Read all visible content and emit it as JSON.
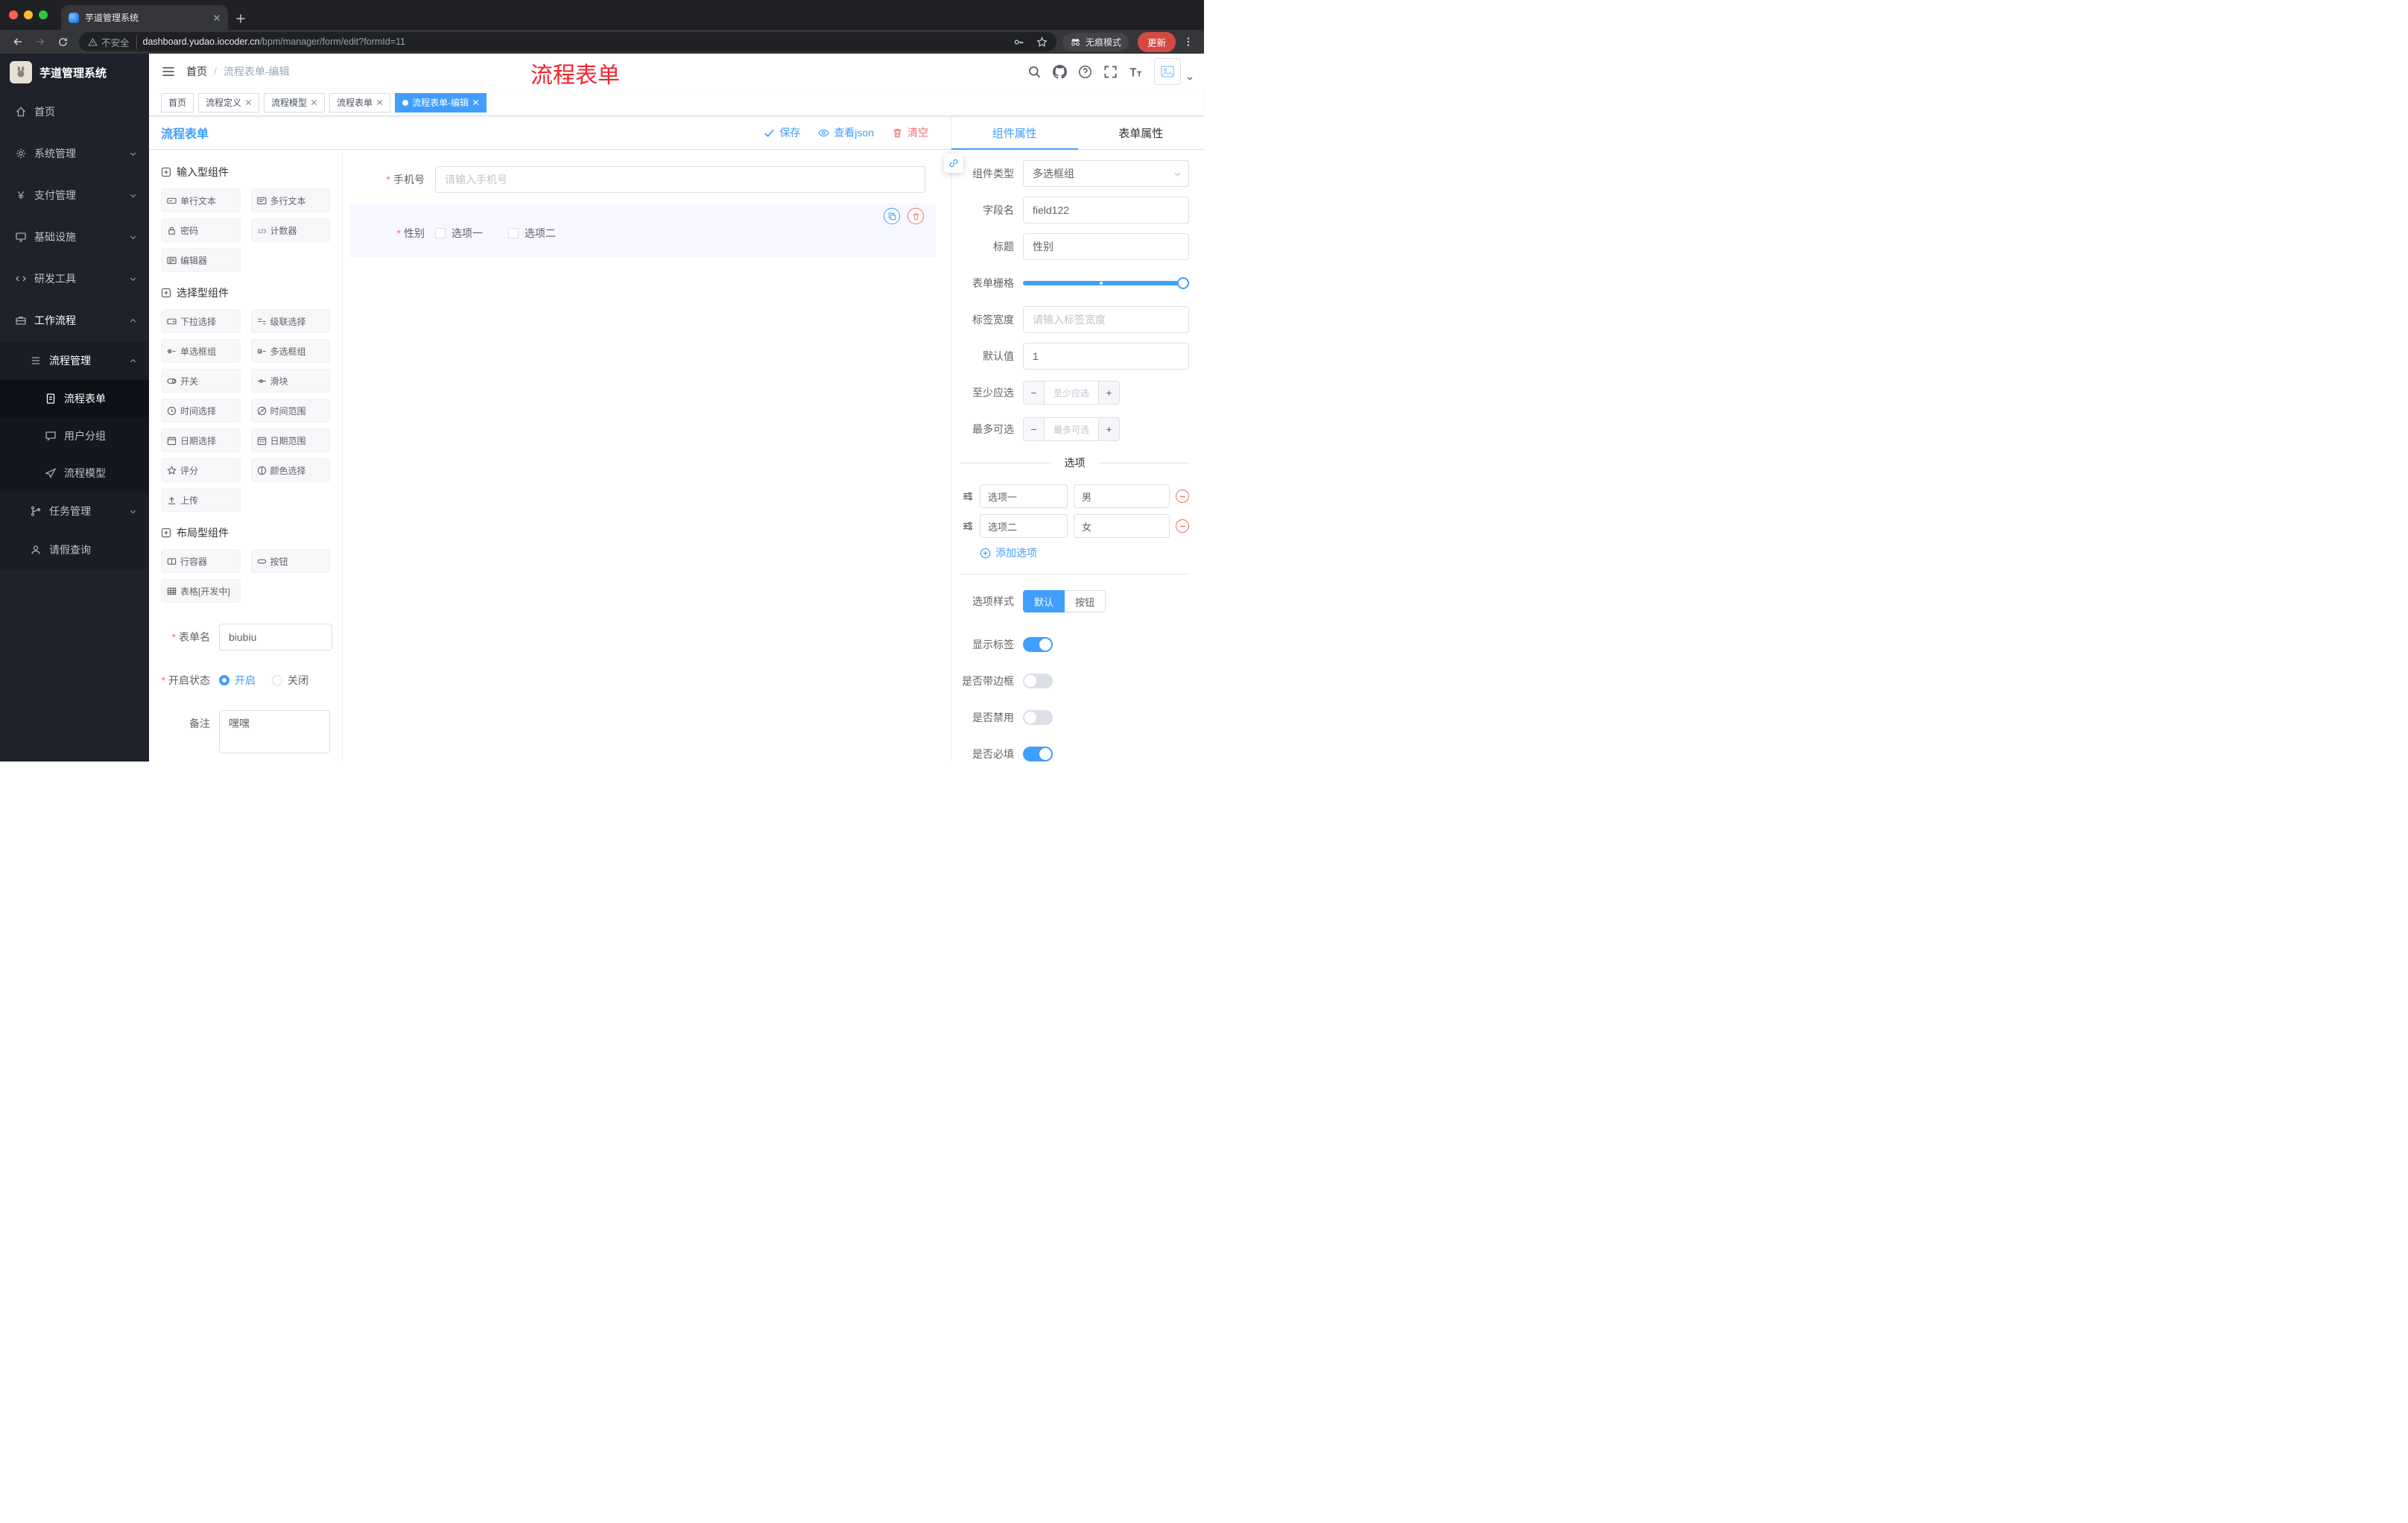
{
  "colors": {
    "accent": "#409eff",
    "danger": "#f56c6c",
    "annotation_red": "#f5222d",
    "active_tag": "#409eff"
  },
  "browser": {
    "tab_title": "芋道管理系统",
    "security_label": "不安全",
    "url_domain": "dashboard.yudao.iocoder.cn",
    "url_path": "/bpm/manager/form/edit?formId=11",
    "incognito_label": "无痕模式",
    "update_label": "更新"
  },
  "sidebar": {
    "logo_title": "芋道管理系统",
    "items": [
      {
        "label": "首页"
      },
      {
        "label": "系统管理"
      },
      {
        "label": "支付管理"
      },
      {
        "label": "基础设施"
      },
      {
        "label": "研发工具"
      },
      {
        "label": "工作流程"
      },
      {
        "label": "流程管理"
      },
      {
        "label": "流程表单"
      },
      {
        "label": "用户分组"
      },
      {
        "label": "流程模型"
      },
      {
        "label": "任务管理"
      },
      {
        "label": "请假查询"
      }
    ]
  },
  "header": {
    "breadcrumb_root": "首页",
    "breadcrumb_sep": "/",
    "breadcrumb_current": "流程表单-编辑",
    "annotation": "流程表单"
  },
  "tags": [
    {
      "label": "首页"
    },
    {
      "label": "流程定义"
    },
    {
      "label": "流程模型"
    },
    {
      "label": "流程表单"
    },
    {
      "label": "流程表单-编辑"
    }
  ],
  "designer": {
    "title": "流程表单",
    "actions": {
      "save": "保存",
      "view_json": "查看json",
      "clear": "清空"
    },
    "palette": {
      "sections": [
        {
          "title": "输入型组件",
          "items": [
            {
              "label": "单行文本"
            },
            {
              "label": "多行文本"
            },
            {
              "label": "密码"
            },
            {
              "label": "计数器"
            },
            {
              "label": "编辑器"
            }
          ]
        },
        {
          "title": "选择型组件",
          "items": [
            {
              "label": "下拉选择"
            },
            {
              "label": "级联选择"
            },
            {
              "label": "单选框组"
            },
            {
              "label": "多选框组"
            },
            {
              "label": "开关"
            },
            {
              "label": "滑块"
            },
            {
              "label": "时间选择"
            },
            {
              "label": "时间范围"
            },
            {
              "label": "日期选择"
            },
            {
              "label": "日期范围"
            },
            {
              "label": "评分"
            },
            {
              "label": "颜色选择"
            },
            {
              "label": "上传"
            }
          ]
        },
        {
          "title": "布局型组件",
          "items": [
            {
              "label": "行容器"
            },
            {
              "label": "按钮"
            },
            {
              "label": "表格[开发中]"
            }
          ]
        }
      ],
      "meta": {
        "name_label": "表单名",
        "name_value": "biubiu",
        "status_label": "开启状态",
        "status_on": "开启",
        "status_off": "关闭",
        "remark_label": "备注",
        "remark_value": "嘿嘿"
      }
    },
    "canvas": {
      "phone": {
        "label": "手机号",
        "placeholder": "请输入手机号"
      },
      "gender": {
        "label": "性别",
        "option1": "选项一",
        "option2": "选项二"
      }
    },
    "props": {
      "tab_component": "组件属性",
      "tab_form": "表单属性",
      "type_label": "组件类型",
      "type_value": "多选框组",
      "field_label": "字段名",
      "field_value": "field122",
      "title_label": "标题",
      "title_value": "性别",
      "grid_label": "表单栅格",
      "width_label": "标签宽度",
      "width_placeholder": "请输入标签宽度",
      "default_label": "默认值",
      "default_value": "1",
      "min_label": "至少应选",
      "min_placeholder": "至少应选",
      "max_label": "最多可选",
      "max_placeholder": "最多可选",
      "options_divider": "选项",
      "options": [
        {
          "name": "选项一",
          "value": "男"
        },
        {
          "name": "选项二",
          "value": "女"
        }
      ],
      "add_option": "添加选项",
      "style_label": "选项样式",
      "style_default": "默认",
      "style_button": "按钮",
      "switch_show_label": "显示标签",
      "switch_border": "是否带边框",
      "switch_disabled": "是否禁用",
      "switch_required": "是否必填"
    }
  }
}
